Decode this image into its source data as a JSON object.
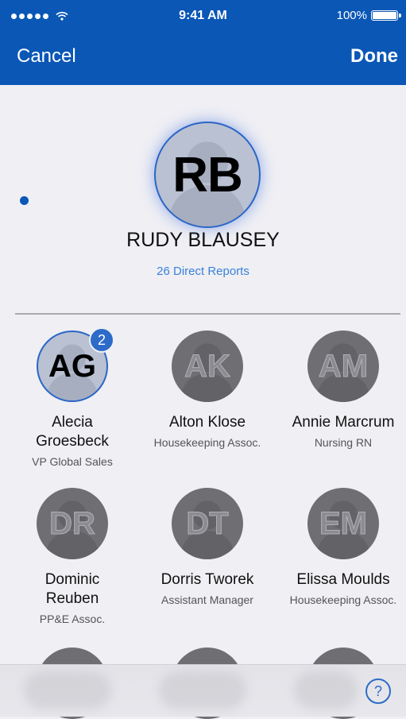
{
  "status_bar": {
    "time": "9:41 AM",
    "battery": "100%"
  },
  "nav": {
    "cancel_label": "Cancel",
    "done_label": "Done"
  },
  "manager": {
    "initials": "RB",
    "name": "RUDY BLAUSEY",
    "reports": "26 Direct Reports"
  },
  "reports": [
    {
      "initials": "AG",
      "name_line1": "Alecia",
      "name_line2": "Groesbeck",
      "title": "VP Global Sales",
      "badge": "2",
      "selected": true
    },
    {
      "initials": "AK",
      "name_line1": "Alton Klose",
      "name_line2": "",
      "title": "Housekeeping Assoc.",
      "badge": "",
      "selected": false
    },
    {
      "initials": "AM",
      "name_line1": "Annie Marcrum",
      "name_line2": "",
      "title": "Nursing RN",
      "badge": "",
      "selected": false
    },
    {
      "initials": "DR",
      "name_line1": "Dominic",
      "name_line2": "Reuben",
      "title": "PP&E Assoc.",
      "badge": "",
      "selected": false
    },
    {
      "initials": "DT",
      "name_line1": "Dorris Tworek",
      "name_line2": "",
      "title": "Assistant Manager",
      "badge": "",
      "selected": false
    },
    {
      "initials": "EM",
      "name_line1": "Elissa Moulds",
      "name_line2": "",
      "title": "Housekeeping Assoc.",
      "badge": "",
      "selected": false
    }
  ],
  "help": {
    "label": "?"
  },
  "colors": {
    "nav_bar": "#0a57b6",
    "accent": "#2d6bc9",
    "link": "#3a82d8",
    "background": "#efeff4"
  },
  "icons": {
    "signal": "signal-dots-icon",
    "wifi": "wifi-icon",
    "battery": "battery-icon",
    "avatar": "person-silhouette-icon",
    "help": "question-circle-icon"
  }
}
